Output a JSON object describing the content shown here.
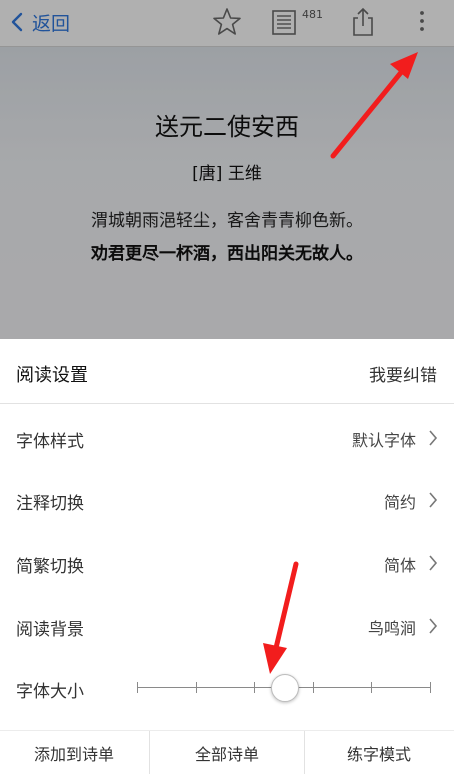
{
  "nav": {
    "back_label": "返回",
    "badge_count": "481",
    "icons": [
      "chevron-left-icon",
      "star-icon",
      "notes-icon",
      "share-icon",
      "more-icon"
    ],
    "accent_color": "#2f74d6"
  },
  "poem": {
    "title": "送元二使安西",
    "author": "[唐] 王维",
    "lines": [
      "渭城朝雨浥轻尘，客舍青青柳色新。",
      "劝君更尽一杯酒，西出阳关无故人。"
    ]
  },
  "settings": {
    "title": "阅读设置",
    "report_label": "我要纠错",
    "rows": [
      {
        "label": "字体样式",
        "value": "默认字体"
      },
      {
        "label": "注释切换",
        "value": "简约"
      },
      {
        "label": "简繁切换",
        "value": "简体"
      },
      {
        "label": "阅读背景",
        "value": "鸟鸣涧"
      }
    ],
    "font_size": {
      "label": "字体大小",
      "steps": 6,
      "selected_step": 3
    }
  },
  "actions": {
    "add_to_list": "添加到诗单",
    "all_lists": "全部诗单",
    "practice_mode": "练字模式"
  },
  "annotation_color": "#f21d1d"
}
